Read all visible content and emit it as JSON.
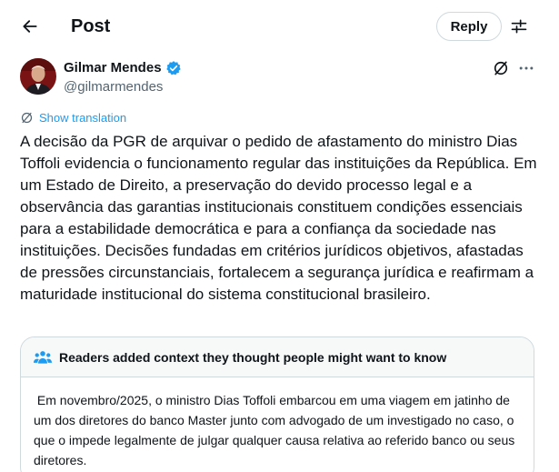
{
  "header": {
    "title": "Post",
    "reply_label": "Reply",
    "back_icon": "arrow-left-icon",
    "adjust_icon": "sliders-icon"
  },
  "author": {
    "name": "Gilmar Mendes",
    "handle": "@gilmarmendes",
    "verified": true
  },
  "translate": {
    "label": "Show translation"
  },
  "post": {
    "text": "A decisão da PGR de arquivar o pedido de afastamento do ministro Dias Toffoli evidencia o funcionamento regular das instituições da República. Em um Estado de Direito, a preservação do devido processo legal e a observância das garantias institucionais constituem condições essenciais para a estabilidade democrática e para a confiança da sociedade nas instituições. Decisões fundadas em critérios jurídicos objetivos, afastadas de pressões circunstanciais, fortalecem a segurança jurídica e reafirmam a maturidade institucional do sistema constitucional brasileiro."
  },
  "community_note": {
    "title": "Readers added context they thought people might want to know",
    "body": " Em novembro/2025, o ministro Dias Toffoli embarcou em uma viagem em jatinho de um dos diretores do banco Master junto com advogado de um investigado no caso, o que o impede legalmente de julgar qualquer causa relativa ao referido banco ou seus diretores."
  },
  "colors": {
    "accent": "#1d9bf0",
    "text": "#0f1419",
    "muted": "#536471",
    "border": "#cfd9de"
  }
}
